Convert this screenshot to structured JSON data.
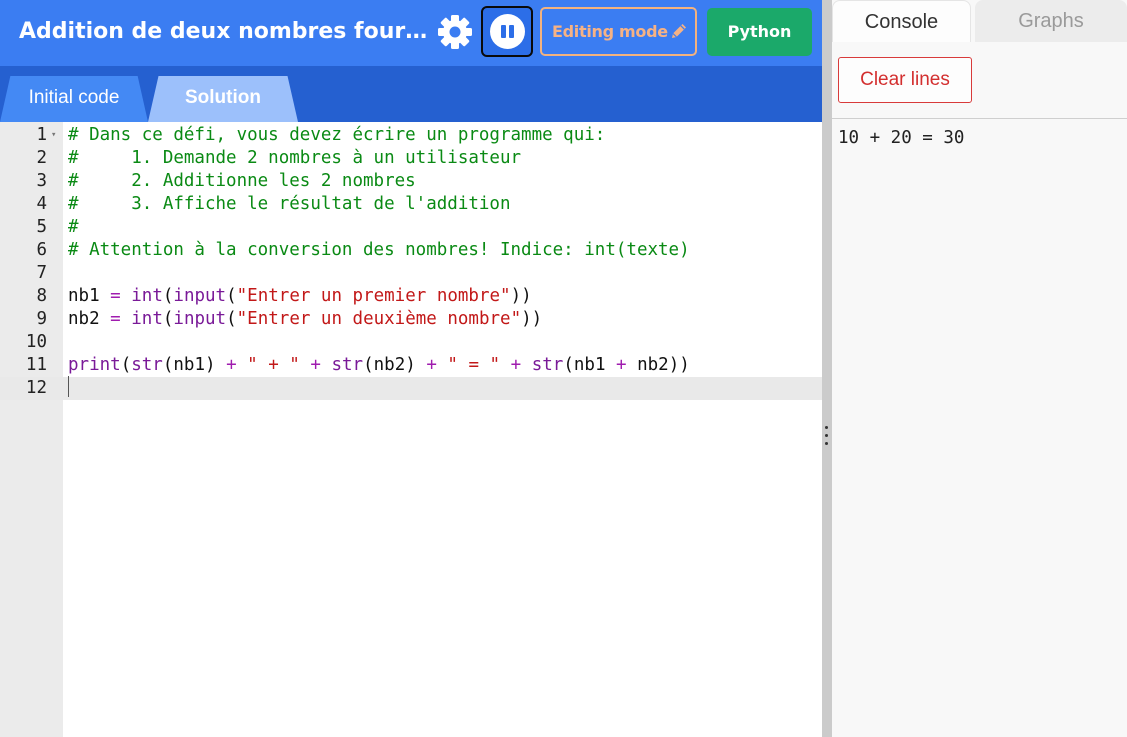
{
  "header": {
    "title": "Addition de deux nombres fourni…",
    "editing_mode_label": "Editing mode",
    "language_label": "Python",
    "accent_color": "#3b7df2"
  },
  "editor_tabs": [
    {
      "label": "Initial code"
    },
    {
      "label": "Solution",
      "active": true
    }
  ],
  "code": {
    "line_numbers": [
      "1",
      "2",
      "3",
      "4",
      "5",
      "6",
      "7",
      "8",
      "9",
      "10",
      "11",
      "12"
    ],
    "lines": [
      [
        {
          "t": "comment",
          "v": "# Dans ce défi, vous devez écrire un programme qui:"
        }
      ],
      [
        {
          "t": "comment",
          "v": "#     1. Demande 2 nombres à un utilisateur"
        }
      ],
      [
        {
          "t": "comment",
          "v": "#     2. Additionne les 2 nombres"
        }
      ],
      [
        {
          "t": "comment",
          "v": "#     3. Affiche le résultat de l'addition"
        }
      ],
      [
        {
          "t": "comment",
          "v": "#"
        }
      ],
      [
        {
          "t": "comment",
          "v": "# Attention à la conversion des nombres! Indice: int(texte)"
        }
      ],
      [],
      [
        {
          "t": "plain",
          "v": "nb1 "
        },
        {
          "t": "op",
          "v": "="
        },
        {
          "t": "plain",
          "v": " "
        },
        {
          "t": "fn",
          "v": "int"
        },
        {
          "t": "plain",
          "v": "("
        },
        {
          "t": "fn",
          "v": "input"
        },
        {
          "t": "plain",
          "v": "("
        },
        {
          "t": "str",
          "v": "\"Entrer un premier nombre\""
        },
        {
          "t": "plain",
          "v": "))"
        }
      ],
      [
        {
          "t": "plain",
          "v": "nb2 "
        },
        {
          "t": "op",
          "v": "="
        },
        {
          "t": "plain",
          "v": " "
        },
        {
          "t": "fn",
          "v": "int"
        },
        {
          "t": "plain",
          "v": "("
        },
        {
          "t": "fn",
          "v": "input"
        },
        {
          "t": "plain",
          "v": "("
        },
        {
          "t": "str",
          "v": "\"Entrer un deuxième nombre\""
        },
        {
          "t": "plain",
          "v": "))"
        }
      ],
      [],
      [
        {
          "t": "fn",
          "v": "print"
        },
        {
          "t": "plain",
          "v": "("
        },
        {
          "t": "fn",
          "v": "str"
        },
        {
          "t": "plain",
          "v": "(nb1) "
        },
        {
          "t": "op",
          "v": "+"
        },
        {
          "t": "plain",
          "v": " "
        },
        {
          "t": "str",
          "v": "\" + \""
        },
        {
          "t": "plain",
          "v": " "
        },
        {
          "t": "op",
          "v": "+"
        },
        {
          "t": "plain",
          "v": " "
        },
        {
          "t": "fn",
          "v": "str"
        },
        {
          "t": "plain",
          "v": "(nb2) "
        },
        {
          "t": "op",
          "v": "+"
        },
        {
          "t": "plain",
          "v": " "
        },
        {
          "t": "str",
          "v": "\" = \""
        },
        {
          "t": "plain",
          "v": " "
        },
        {
          "t": "op",
          "v": "+"
        },
        {
          "t": "plain",
          "v": " "
        },
        {
          "t": "fn",
          "v": "str"
        },
        {
          "t": "plain",
          "v": "(nb1 "
        },
        {
          "t": "op",
          "v": "+"
        },
        {
          "t": "plain",
          "v": " nb2))"
        }
      ],
      []
    ],
    "active_line": 12
  },
  "right_panel": {
    "tabs": [
      {
        "label": "Console",
        "active": true
      },
      {
        "label": "Graphs"
      }
    ],
    "clear_label": "Clear lines",
    "console_output": "10 + 20 = 30"
  },
  "icons": {
    "settings": "gear-icon",
    "run_toggle": "pause-icon",
    "edit": "pencil-icon",
    "fold": "fold-arrow-icon",
    "resize": "drag-handle-icon"
  }
}
